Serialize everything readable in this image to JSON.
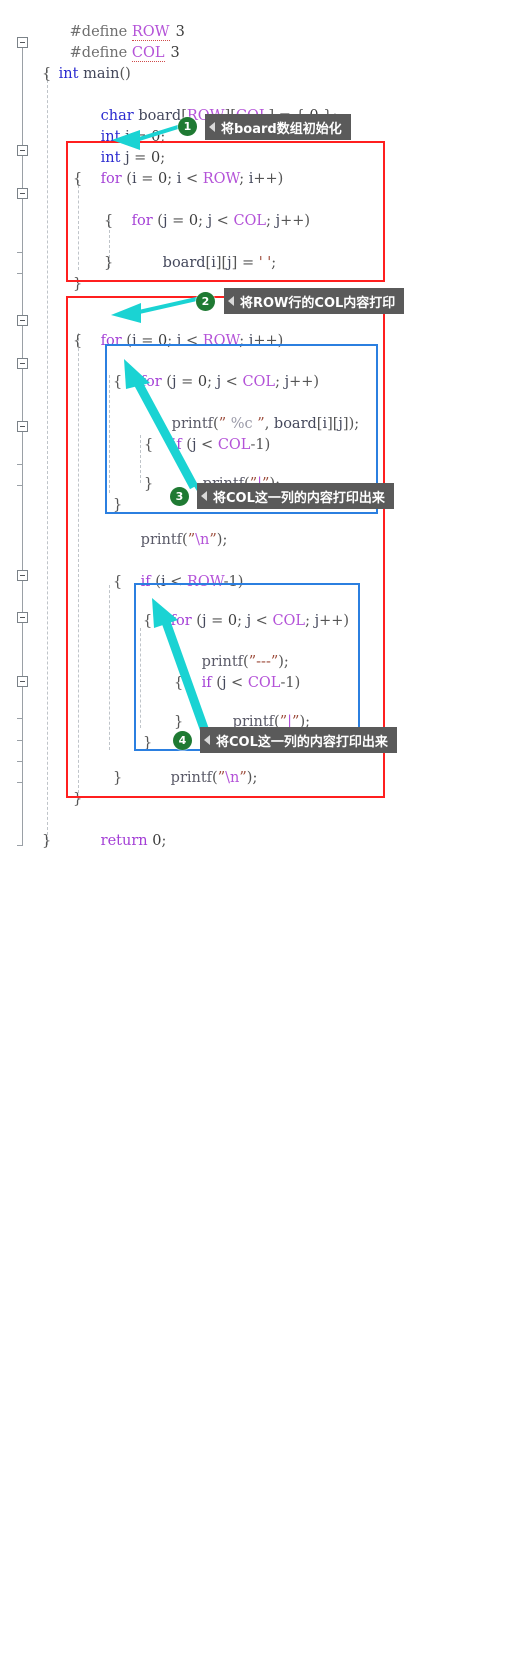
{
  "editor": {
    "language": "C",
    "background": "#ffffff",
    "code_lines": [
      "#define ROW 3",
      "#define COL 3",
      "int main()",
      "{",
      "    char board[ROW][COL] = { 0 };",
      "    int i = 0;",
      "    int j = 0;",
      "    for (i = 0; i < ROW; i++)",
      "    {",
      "        for (j = 0; j < COL; j++)",
      "        {",
      "            board[i][j] = ' ';",
      "        }",
      "    }",
      "",
      "    for (i = 0; i < ROW; i++)",
      "    {",
      "        for (j = 0; j < COL; j++)",
      "        {",
      "            printf(\" %c \", board[i][j]);",
      "            if (j < COL-1)",
      "            {",
      "                printf(\"|\");",
      "            }",
      "        }",
      "        printf(\"\\n\");",
      "",
      "        if (i < ROW-1)",
      "        {",
      "            for (j = 0; j < COL; j++)",
      "            {",
      "                printf(\"---\");",
      "                if (j < COL-1)",
      "                {",
      "                    printf(\"|\");",
      "                }",
      "            }",
      "            printf(\"\\n\");",
      "        }",
      "    }",
      "    return 0;",
      "}"
    ]
  },
  "tokens": {
    "define": "#define",
    "row": "ROW",
    "col": "COL",
    "three": "3",
    "int": "int",
    "char": "char",
    "main": "main",
    "board": "board",
    "for": "for",
    "if": "if",
    "return": "return",
    "printf": "printf",
    "zero": "0",
    "i": "i",
    "j": "j",
    "fmt_c": "%c",
    "fmt_newline": "\\n",
    "fmt_bar": "|",
    "fmt_dashes": "---",
    "space_char": "' '"
  },
  "annotations": {
    "colors": {
      "red_box": "#ff1f1f",
      "blue_box": "#2b7fe0",
      "callout_bg": "#5a5a5a",
      "badge_bg": "#1f7a33",
      "arrow": "#1ad3d3"
    },
    "callouts": [
      {
        "number": "1",
        "text": "将board数组初始化"
      },
      {
        "number": "2",
        "text": "将ROW行的COL内容打印"
      },
      {
        "number": "3",
        "text": "将COL这一列的内容打印出来"
      },
      {
        "number": "4",
        "text": "将COL这一列的内容打印出来"
      }
    ],
    "boxes": [
      {
        "name": "init-loop-red-box",
        "color": "#ff1f1f"
      },
      {
        "name": "print-loop-red-box",
        "color": "#ff1f1f"
      },
      {
        "name": "col-print-blue-box",
        "color": "#2b7fe0"
      },
      {
        "name": "row-sep-blue-box",
        "color": "#2b7fe0"
      }
    ]
  }
}
